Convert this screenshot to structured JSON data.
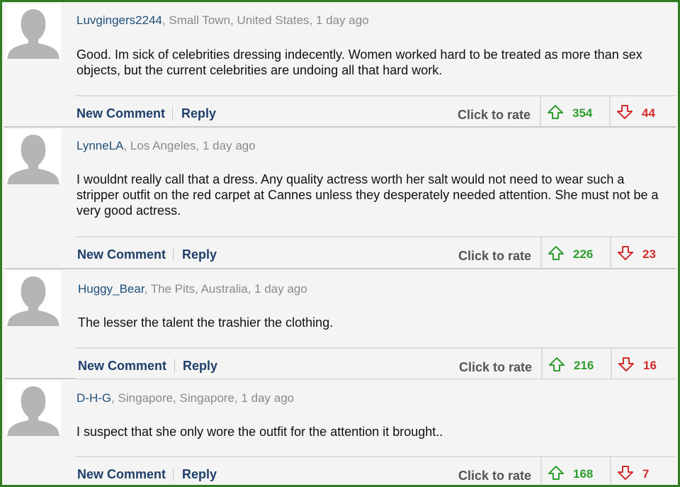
{
  "colors": {
    "frame_border": "#2f7d1f",
    "username": "#1f4f7a",
    "action_link": "#1f3f6b",
    "upvote": "#2e9d2e",
    "downvote": "#d42b2b"
  },
  "icons": {
    "avatar": "default-avatar-silhouette",
    "upvote": "arrow-up-outline-icon",
    "downvote": "arrow-down-outline-icon"
  },
  "comments": [
    {
      "username": "Luvgingers2244",
      "location_time": ", Small Town, United States, 1 day ago",
      "text": "Good. Im sick of celebrities dressing indecently. Women worked hard to be treated as more than sex objects, but the current celebrities are undoing all that hard work.",
      "new_comment_label": "New Comment",
      "reply_label": "Reply",
      "rate_label": "Click to rate",
      "upvotes": "354",
      "downvotes": "44"
    },
    {
      "username": "LynneLA",
      "location_time": ", Los Angeles, 1 day ago",
      "text": "I wouldnt really call that a dress. Any quality actress worth her salt would not need to wear such a stripper outfit on the red carpet at Cannes unless they desperately needed attention. She must not be a very good actress.",
      "new_comment_label": "New Comment",
      "reply_label": "Reply",
      "rate_label": "Click to rate",
      "upvotes": "226",
      "downvotes": "23"
    },
    {
      "username": "Huggy_Bear",
      "location_time": ", The Pits, Australia, 1 day ago",
      "text": "The lesser the talent the trashier the clothing.",
      "new_comment_label": "New Comment",
      "reply_label": "Reply",
      "rate_label": "Click to rate",
      "upvotes": "216",
      "downvotes": "16"
    },
    {
      "username": "D-H-G",
      "location_time": ", Singapore, Singapore, 1 day ago",
      "text": "I suspect that she only wore the outfit for the attention it brought..",
      "new_comment_label": "New Comment",
      "reply_label": "Reply",
      "rate_label": "Click to rate",
      "upvotes": "168",
      "downvotes": "7"
    }
  ]
}
